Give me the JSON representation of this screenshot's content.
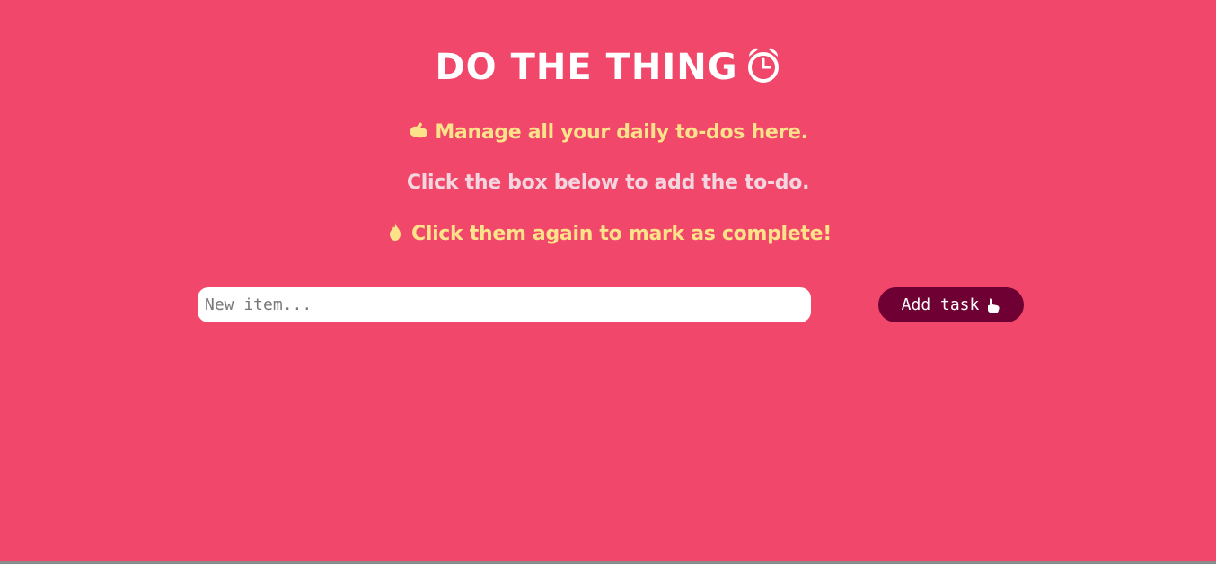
{
  "header": {
    "title": "DO THE THING",
    "title_icon": "alarm-clock-icon"
  },
  "instructions": {
    "line1": {
      "icon": "flexed-biceps-icon",
      "text": "Manage all your daily to-dos here."
    },
    "line2": {
      "text": "Click the box below to add the to-do."
    },
    "line3": {
      "icon": "fire-icon",
      "text": "Click them again to mark as complete!"
    }
  },
  "form": {
    "input_value": "",
    "input_placeholder": "New item...",
    "add_button_label": "Add task",
    "add_button_icon": "pointing-hand-icon"
  },
  "colors": {
    "background": "#f1476a",
    "title": "#ffffff",
    "highlight_text": "#fce38a",
    "muted_text": "#f3d6df",
    "button": "#6e0033"
  }
}
